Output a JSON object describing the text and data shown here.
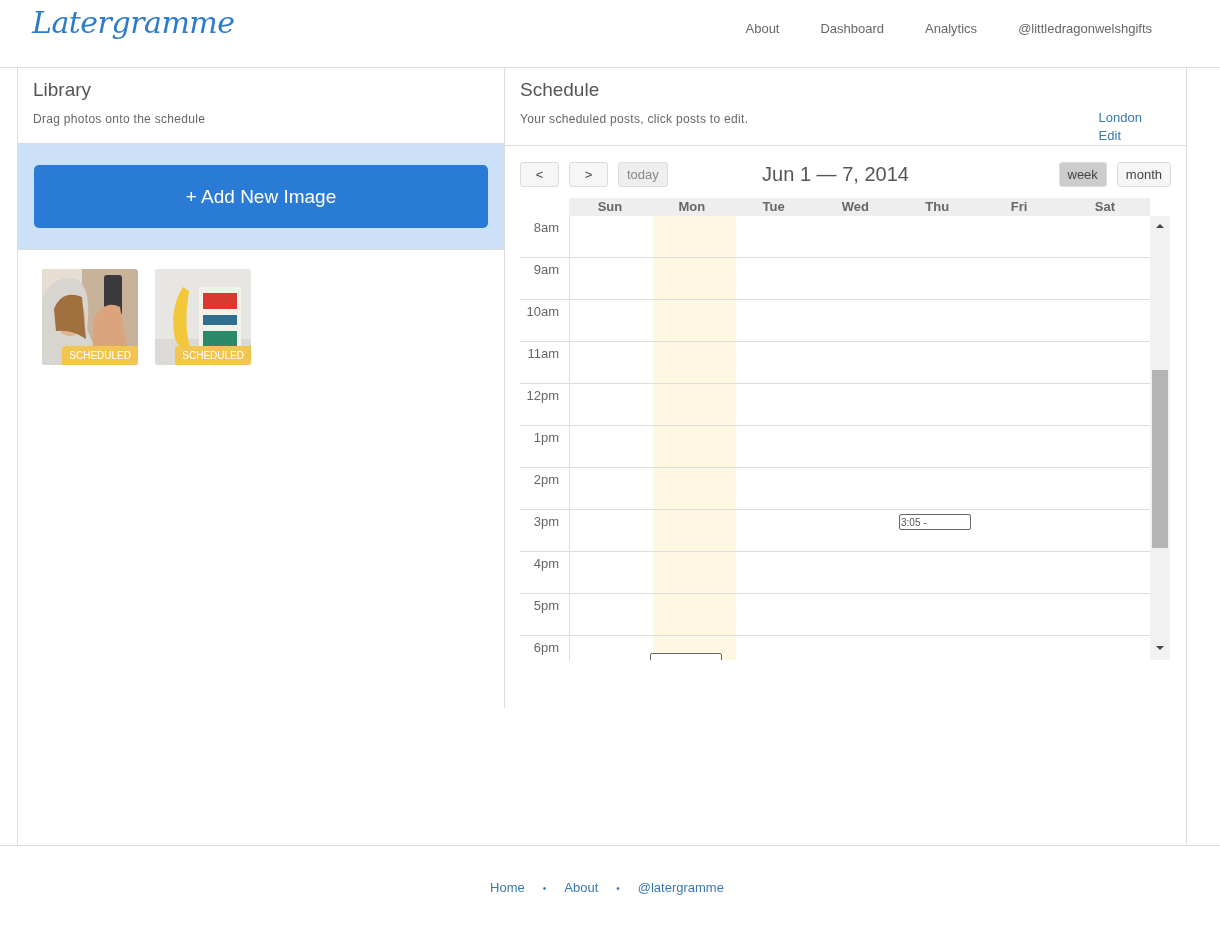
{
  "header": {
    "logo": "Latergramme",
    "nav": [
      {
        "label": "About"
      },
      {
        "label": "Dashboard"
      },
      {
        "label": "Analytics"
      },
      {
        "label": "@littledragonwelshgifts"
      }
    ]
  },
  "library": {
    "title": "Library",
    "subtitle": "Drag photos onto the schedule",
    "add_button": "+ Add New Image",
    "images": [
      {
        "kind": "picture",
        "badge": "SCHEDULED"
      },
      {
        "kind": "picture",
        "badge": "SCHEDULED"
      }
    ]
  },
  "schedule": {
    "title": "Schedule",
    "subtitle": "Your scheduled posts, click posts to edit.",
    "timezone": "London",
    "timezone_edit": "Edit",
    "prev": "<",
    "next": ">",
    "today": "today",
    "range": "Jun 1 — 7, 2014",
    "views": [
      {
        "label": "week",
        "selected": true
      },
      {
        "label": "month",
        "selected": false
      }
    ],
    "days": [
      {
        "label": "Sun",
        "today": false
      },
      {
        "label": "Mon",
        "today": true
      },
      {
        "label": "Tue",
        "today": false
      },
      {
        "label": "Wed",
        "today": false
      },
      {
        "label": "Thu",
        "today": false
      },
      {
        "label": "Fri",
        "today": false
      },
      {
        "label": "Sat",
        "today": false
      }
    ],
    "rows": [
      {
        "label": "8am",
        "events": []
      },
      {
        "label": "9am",
        "events": []
      },
      {
        "label": "10am",
        "events": []
      },
      {
        "label": "11am",
        "events": []
      },
      {
        "label": "12pm",
        "events": []
      },
      {
        "label": "1pm",
        "events": []
      },
      {
        "label": "2pm",
        "events": []
      },
      {
        "label": "3pm",
        "events": [
          {
            "kind": "thu",
            "clipped": false,
            "text": "3:05 -"
          }
        ]
      },
      {
        "label": "4pm",
        "events": []
      },
      {
        "label": "5pm",
        "events": []
      },
      {
        "label": "6pm",
        "events": [
          {
            "kind": "mon",
            "clipped": true
          }
        ]
      }
    ]
  },
  "footer": {
    "links": [
      {
        "label": "Home"
      },
      {
        "label": "About"
      },
      {
        "label": "@latergramme"
      }
    ],
    "separator": "•"
  }
}
